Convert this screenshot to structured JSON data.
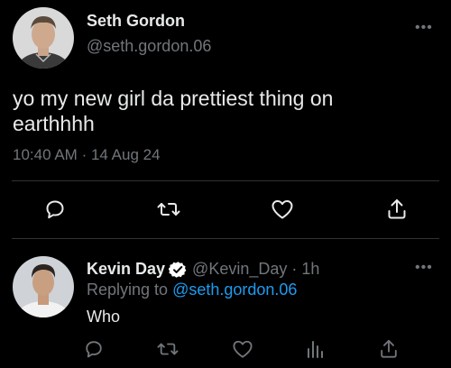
{
  "main_tweet": {
    "author_name": "Seth Gordon",
    "author_handle": "@seth.gordon.06",
    "more_label": "•••",
    "text_line1": "yo my new girl da prettiest thing on",
    "text_line2": "earthhhh",
    "time": "10:40 AM",
    "separator": "·",
    "date": "14 Aug 24",
    "actions": [
      "reply-icon",
      "retweet-icon",
      "like-icon",
      "share-icon"
    ]
  },
  "reply_tweet": {
    "author_name": "Kevin Day",
    "verified_icon": "verified-badge-icon",
    "author_handle": "@Kevin_Day",
    "separator": "·",
    "age": "1h",
    "more_label": "•••",
    "replying_prefix": "Replying to",
    "replying_handle": "@seth.gordon.06",
    "text": "Who",
    "actions": [
      "reply-icon",
      "retweet-icon",
      "like-icon",
      "views-icon",
      "share-icon"
    ]
  },
  "colors": {
    "background": "#000000",
    "text": "#e7e9ea",
    "muted": "#71767b",
    "link": "#1d9bf0",
    "divider": "#2f3336"
  }
}
